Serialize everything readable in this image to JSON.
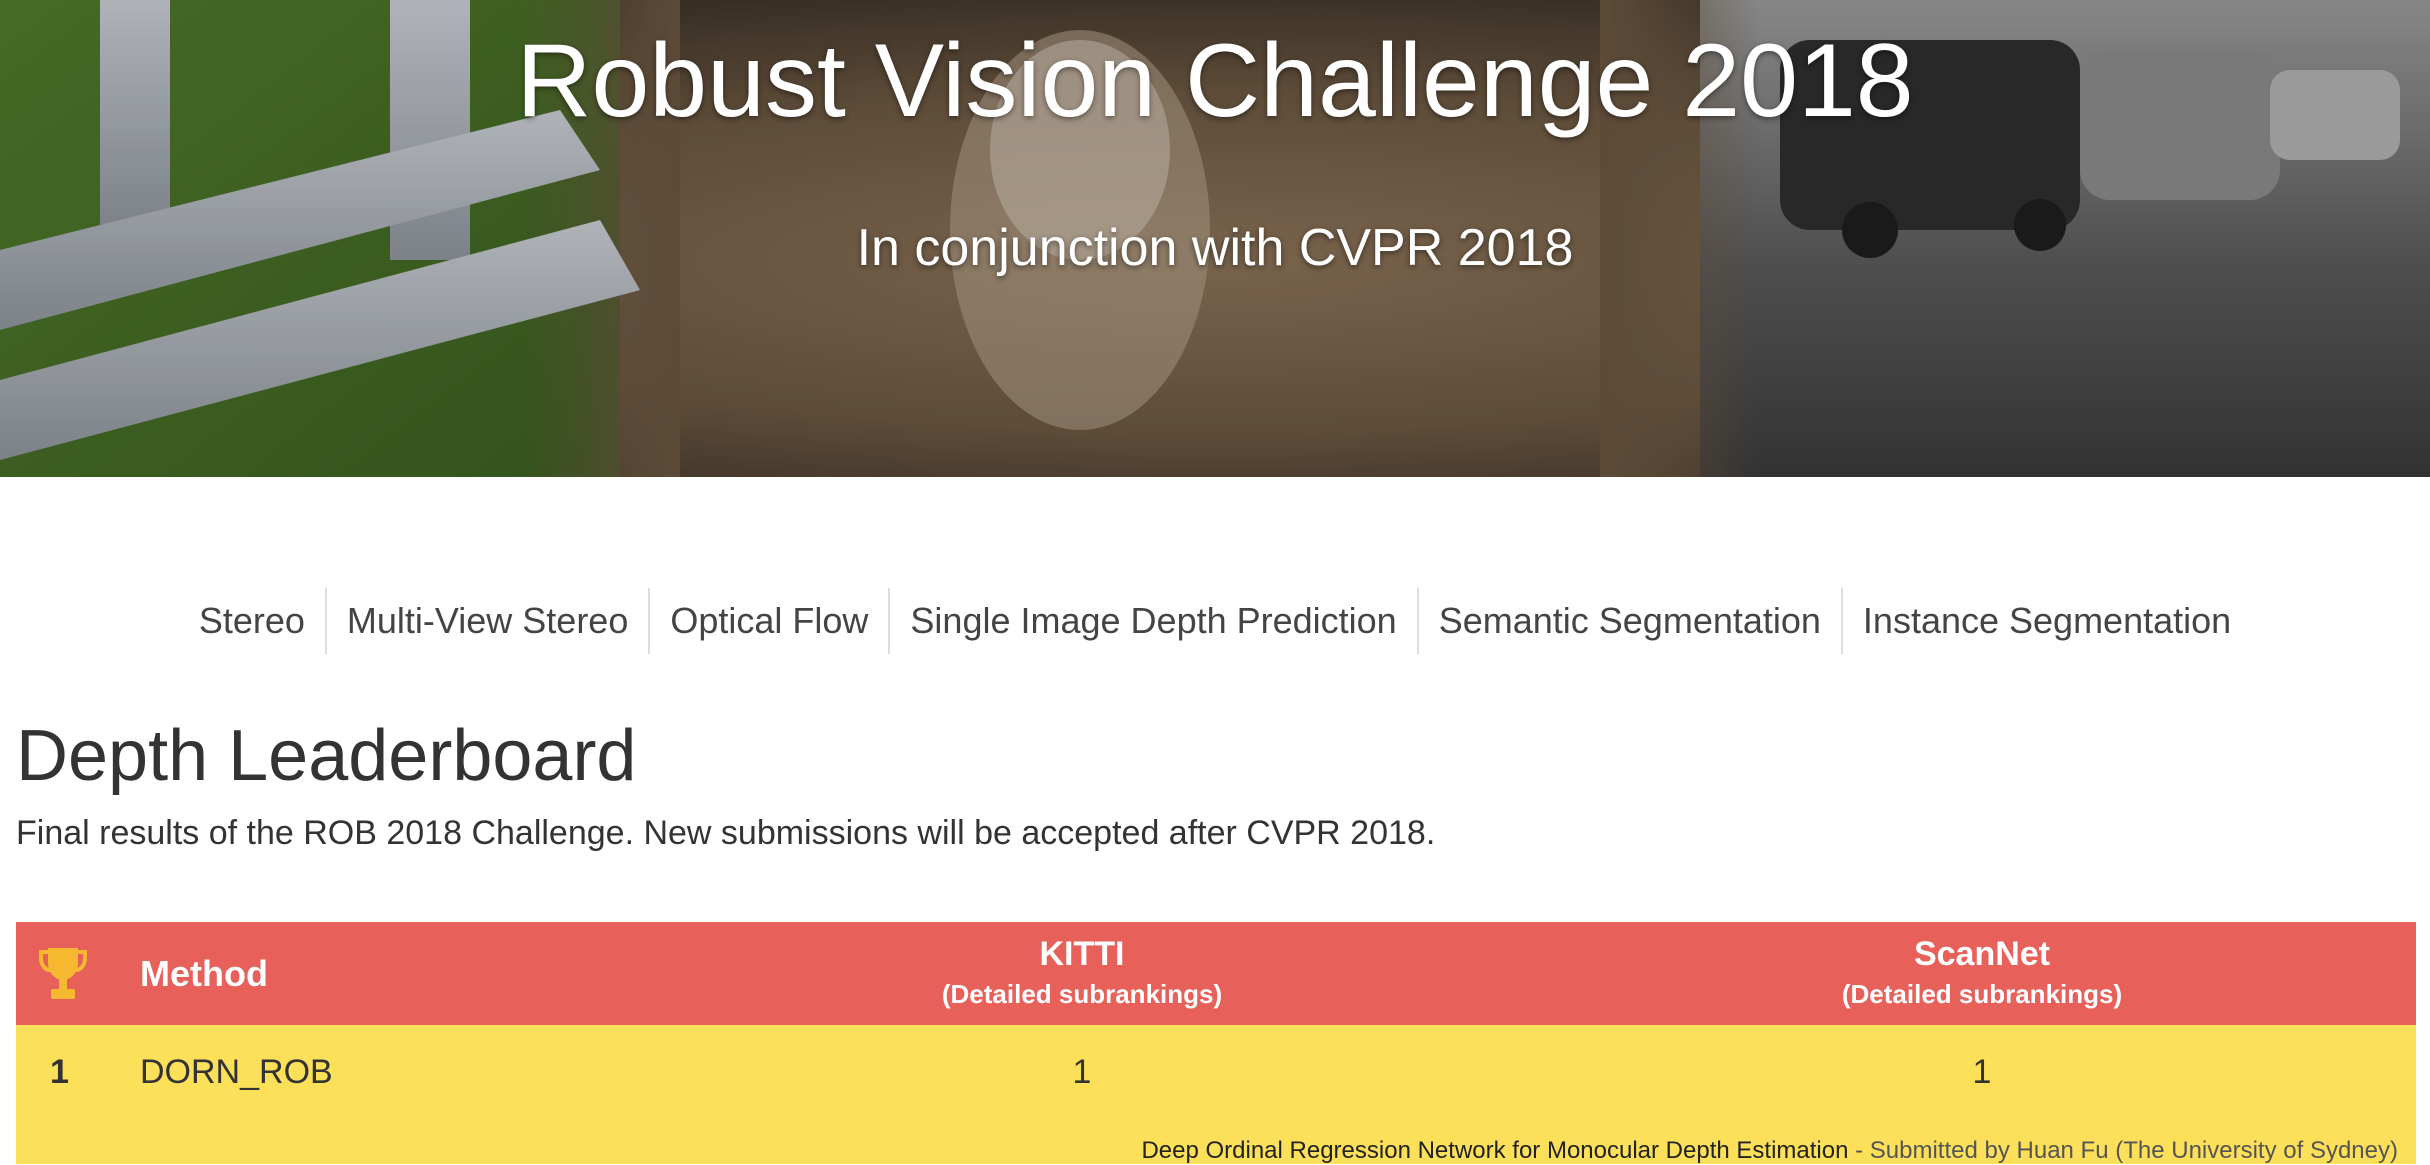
{
  "hero": {
    "title": "Robust Vision Challenge 2018",
    "subtitle": "In conjunction with CVPR 2018"
  },
  "nav": {
    "items": [
      "Stereo",
      "Multi-View Stereo",
      "Optical Flow",
      "Single Image Depth Prediction",
      "Semantic Segmentation",
      "Instance Segmentation"
    ]
  },
  "page": {
    "title": "Depth Leaderboard",
    "description": "Final results of the ROB 2018 Challenge. New submissions will be accepted after CVPR 2018."
  },
  "table": {
    "header": {
      "trophy_icon": "trophy-icon",
      "method": "Method",
      "columns": [
        {
          "name": "KITTI",
          "sub": "(Detailed subrankings)"
        },
        {
          "name": "ScanNet",
          "sub": "(Detailed subrankings)"
        }
      ]
    },
    "rows": [
      {
        "rank": "1",
        "method": "DORN_ROB",
        "kitti": "1",
        "scannet": "1",
        "paper": "Deep Ordinal Regression Network for Monocular Depth Estimation",
        "separator": " - ",
        "submitted_by": "Submitted by Huan Fu (The University of Sydney)"
      }
    ]
  },
  "colors": {
    "header_bg": "#e8605a",
    "winner_row_bg": "#fde05a",
    "trophy": "#f5b82e"
  }
}
